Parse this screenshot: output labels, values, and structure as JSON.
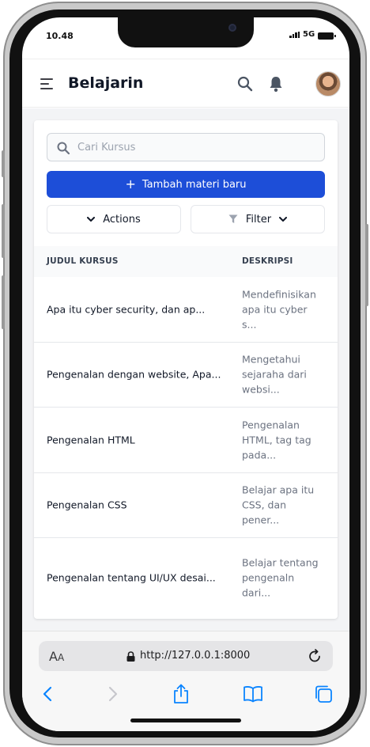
{
  "status_bar": {
    "time": "10.48",
    "network": "5G"
  },
  "header": {
    "title": "Belajarin"
  },
  "search": {
    "placeholder": "Cari Kursus"
  },
  "toolbar": {
    "add_label": "Tambah materi baru",
    "actions_label": "Actions",
    "filter_label": "Filter"
  },
  "table": {
    "columns": [
      "JUDUL KURSUS",
      "DESKRIPSI"
    ],
    "rows": [
      {
        "title": "Apa itu cyber security, dan ap...",
        "desc": "Mendefinisikan apa itu cyber s..."
      },
      {
        "title": "Pengenalan dengan website, Apa...",
        "desc": "Mengetahui sejaraha dari websi..."
      },
      {
        "title": "Pengenalan HTML",
        "desc": "Pengenalan HTML, tag tag pada..."
      },
      {
        "title": "Pengenalan CSS",
        "desc": "Belajar apa itu CSS, dan pener..."
      },
      {
        "title": "Pengenalan tentang UI/UX desai...",
        "desc": "Belajar tentang pengenaln dari..."
      }
    ]
  },
  "browser": {
    "text_size_label": "A",
    "text_size_label_small": "A",
    "url": "http://127.0.0.1:8000"
  },
  "colors": {
    "primary": "#1d4ed8",
    "ios_blue": "#0a84ff"
  }
}
